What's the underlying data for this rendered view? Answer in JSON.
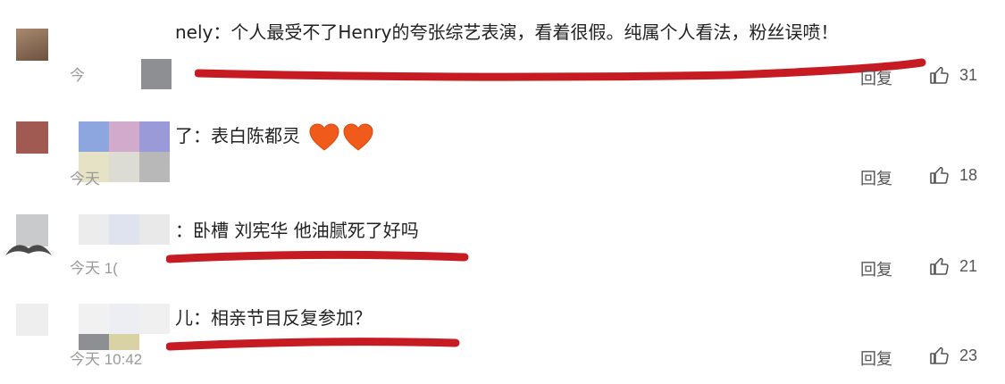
{
  "colors": {
    "underline": "#c61b22",
    "heart": "#f05a1a",
    "muted_text": "#9a9a9a",
    "action_text": "#555555"
  },
  "comments": [
    {
      "text": "nely：个人最受不了Henry的夸张综艺表演，看着很假。纯属个人看法，粉丝误喷！",
      "time": "今",
      "reply_label": "回复",
      "likes": "31",
      "underlined": true
    },
    {
      "text": "了：表白陈都灵",
      "time": "今天",
      "reply_label": "回复",
      "likes": "18",
      "underlined": false,
      "emoji": [
        "orange-heart-icon",
        "orange-heart-icon"
      ]
    },
    {
      "text": "：卧槽 刘宪华 他油腻死了好吗",
      "time": "今天 1(",
      "reply_label": "回复",
      "likes": "21",
      "underlined": true
    },
    {
      "text": "儿：相亲节目反复参加？",
      "time": "今天 10:42",
      "reply_label": "回复",
      "likes": "23",
      "underlined": true
    }
  ]
}
